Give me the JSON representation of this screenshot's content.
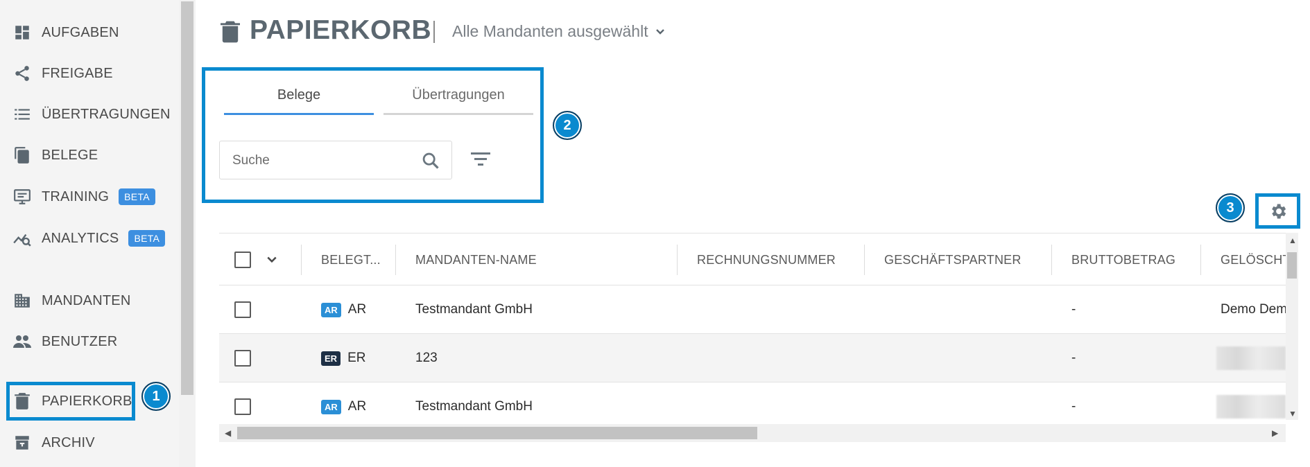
{
  "sidebar": {
    "items": [
      {
        "label": "AUFGABEN",
        "icon": "dashboard-icon"
      },
      {
        "label": "FREIGABE",
        "icon": "share-icon"
      },
      {
        "label": "ÜBERTRAGUNGEN",
        "icon": "list-icon"
      },
      {
        "label": "BELEGE",
        "icon": "documents-icon"
      },
      {
        "label": "TRAINING",
        "icon": "training-icon",
        "badge": "BETA"
      },
      {
        "label": "ANALYTICS",
        "icon": "analytics-icon",
        "badge": "BETA"
      },
      {
        "label": "MANDANTEN",
        "icon": "building-icon"
      },
      {
        "label": "BENUTZER",
        "icon": "users-icon"
      },
      {
        "label": "PAPIERKORB",
        "icon": "trash-icon",
        "active": true
      },
      {
        "label": "ARCHIV",
        "icon": "archive-icon"
      }
    ]
  },
  "header": {
    "title": "PAPIERKORB",
    "mandant_select": "Alle Mandanten ausgewählt"
  },
  "tabs": [
    {
      "label": "Belege",
      "active": true
    },
    {
      "label": "Übertragungen",
      "active": false
    }
  ],
  "search": {
    "placeholder": "Suche",
    "value": ""
  },
  "annotations": [
    "1",
    "2",
    "3"
  ],
  "table": {
    "columns": [
      "BELEGT...",
      "MANDANTEN-NAME",
      "RECHNUNGSNUMMER",
      "GESCHÄFTSPARTNER",
      "BRUTTOBETRAG",
      "GELÖSCHT"
    ],
    "rows": [
      {
        "type_badge": "AR",
        "type": "AR",
        "mandant": "Testmandant GmbH",
        "rechnungsnummer": "",
        "geschaeftspartner": "",
        "brutto": "-",
        "geloescht": "Demo Dem"
      },
      {
        "type_badge": "ER",
        "type": "ER",
        "mandant": "123",
        "rechnungsnummer": "",
        "geschaeftspartner": "",
        "brutto": "-",
        "geloescht": ""
      },
      {
        "type_badge": "AR",
        "type": "AR",
        "mandant": "Testmandant GmbH",
        "rechnungsnummer": "",
        "geschaeftspartner": "",
        "brutto": "-",
        "geloescht": ""
      }
    ]
  },
  "colors": {
    "accent": "#0a8acf",
    "tab_active": "#3d8fe0",
    "badge_ar": "#2b8fd6",
    "badge_er": "#1d2f45",
    "beta": "#3d8fe0"
  }
}
